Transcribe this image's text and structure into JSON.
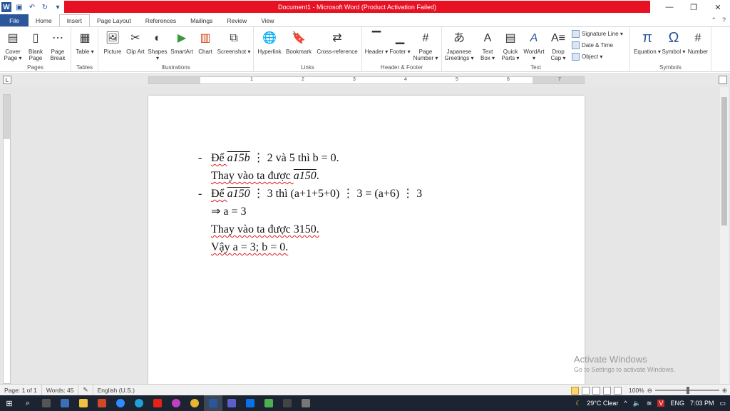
{
  "window": {
    "title": "Document1 - Microsoft Word (Product Activation Failed)",
    "minimize_icon": "minimize-icon",
    "maximize_icon": "restore-icon",
    "close_icon": "close-icon"
  },
  "tabs": [
    "File",
    "Home",
    "Insert",
    "Page Layout",
    "References",
    "Mailings",
    "Review",
    "View"
  ],
  "active_tab": "Insert",
  "ribbon": {
    "pages": {
      "label": "Pages",
      "buttons": [
        "Cover Page ▾",
        "Blank Page",
        "Page Break"
      ]
    },
    "tables": {
      "label": "Tables",
      "buttons": [
        "Table ▾"
      ]
    },
    "illustrations": {
      "label": "Illustrations",
      "buttons": [
        "Picture",
        "Clip Art",
        "Shapes ▾",
        "SmartArt",
        "Chart",
        "Screenshot ▾"
      ]
    },
    "links": {
      "label": "Links",
      "buttons": [
        "Hyperlink",
        "Bookmark",
        "Cross-reference"
      ]
    },
    "header_footer": {
      "label": "Header & Footer",
      "buttons": [
        "Header ▾",
        "Footer ▾",
        "Page Number ▾"
      ]
    },
    "text": {
      "label": "Text",
      "buttons": [
        "Japanese Greetings ▾",
        "Text Box ▾",
        "Quick Parts ▾",
        "WordArt ▾",
        "Drop Cap ▾"
      ],
      "small": [
        "Signature Line ▾",
        "Date & Time",
        "Object ▾"
      ]
    },
    "symbols": {
      "label": "Symbols",
      "buttons": [
        "Equation ▾",
        "Symbol ▾",
        "Number"
      ]
    }
  },
  "ruler_numbers": [
    "1",
    "2",
    "3",
    "4",
    "5",
    "6",
    "7"
  ],
  "document": {
    "lines": [
      {
        "bullet": "-",
        "prefix": "Để ",
        "math": "a15b",
        "suffix": " ⋮ 2 và 5 thì b = 0."
      },
      {
        "bullet": "",
        "prefix": "Thay vào ta được ",
        "math": "a150",
        "suffix": "."
      },
      {
        "bullet": "-",
        "prefix": "Để ",
        "math": "a150",
        "suffix": " ⋮ 3 thì (a+1+5+0) ⋮ 3 = (a+6) ⋮ 3"
      },
      {
        "bullet": "",
        "prefix": "⇒ a = 3",
        "math": "",
        "suffix": ""
      },
      {
        "bullet": "",
        "prefix": "Thay vào ta được 3150.",
        "math": "",
        "suffix": ""
      },
      {
        "bullet": "",
        "prefix": "Vậy a = 3; b = 0.",
        "math": "",
        "suffix": ""
      }
    ]
  },
  "watermark": {
    "line1": "Activate Windows",
    "line2": "Go to Settings to activate Windows."
  },
  "status": {
    "page": "Page: 1 of 1",
    "words": "Words: 45",
    "language": "English (U.S.)",
    "zoom": "100%"
  },
  "taskbar": {
    "weather": "29°C  Clear",
    "lang": "ENG",
    "time": "7:03 PM"
  },
  "colors": {
    "title_bar_alert": "#e81123",
    "word_blue": "#2b579a",
    "taskbar": "#1c2331"
  }
}
